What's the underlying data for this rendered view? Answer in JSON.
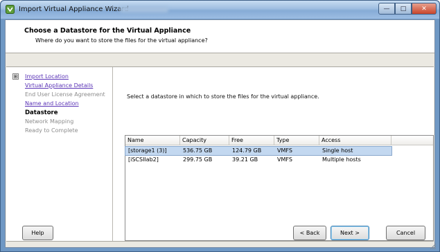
{
  "window": {
    "title": "Import Virtual Appliance Wizard",
    "controls": {
      "minimize": "—",
      "maximize": "□",
      "close": "✕"
    }
  },
  "header": {
    "title": "Choose a Datastore for the Virtual Appliance",
    "subtitle": "Where do you want to store the files for the virtual appliance?"
  },
  "nav": {
    "expander": "⊞",
    "items": [
      {
        "label": "Import Location",
        "state": "link"
      },
      {
        "label": "Virtual Appliance Details",
        "state": "link"
      },
      {
        "label": "End User License Agreement",
        "state": "disabled"
      },
      {
        "label": "Name and Location",
        "state": "link"
      },
      {
        "label": "Datastore",
        "state": "current"
      },
      {
        "label": "Network Mapping",
        "state": "disabled"
      },
      {
        "label": "Ready to Complete",
        "state": "disabled"
      }
    ]
  },
  "main": {
    "instructions": "Select a datastore in which to store the files for the virtual appliance."
  },
  "table": {
    "columns": [
      "Name",
      "Capacity",
      "Free",
      "Type",
      "Access"
    ],
    "rows": [
      {
        "cells": [
          "[storage1 (3)]",
          "536.75 GB",
          "124.79 GB",
          "VMFS",
          "Single host"
        ],
        "selected": true
      },
      {
        "cells": [
          "[iSCSIlab2]",
          "299.75 GB",
          "39.21 GB",
          "VMFS",
          "Multiple hosts"
        ],
        "selected": false
      }
    ]
  },
  "footer": {
    "help": "Help",
    "back": "< Back",
    "next": "Next >",
    "cancel": "Cancel"
  },
  "colors": {
    "title_bar": "#9ebde0",
    "link": "#5a33b6",
    "selection": "#c3d8f0",
    "close_button": "#c8452b"
  }
}
